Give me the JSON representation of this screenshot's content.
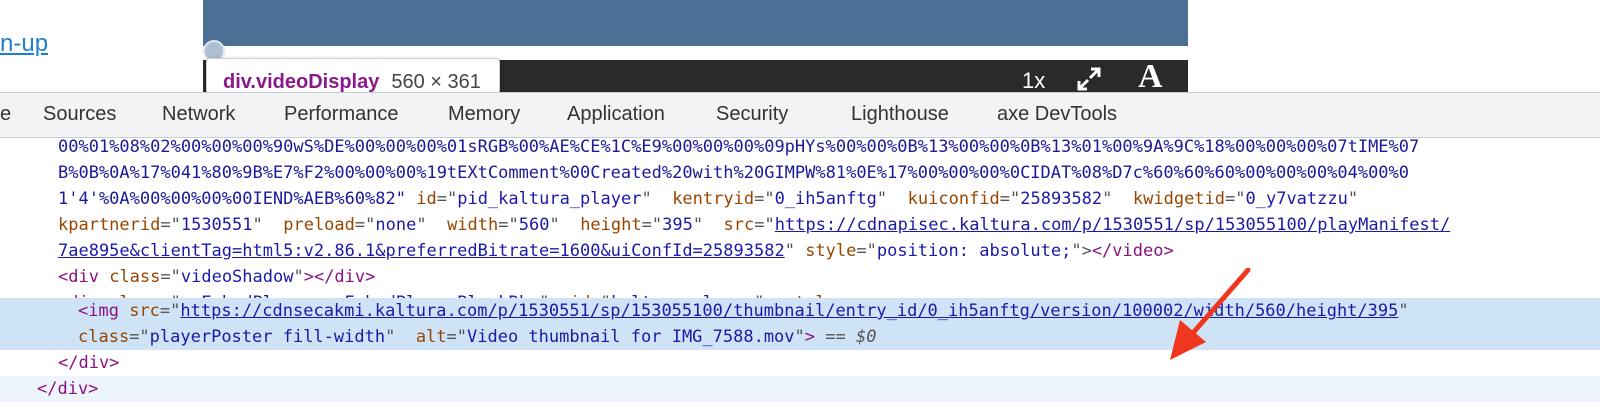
{
  "page": {
    "link_text": "n-up",
    "tooltip": {
      "name": "div.videoDisplay",
      "dims": "560 × 361"
    },
    "player_controls": {
      "rate": "1x",
      "a_label": "A"
    }
  },
  "devtools": {
    "tabs": [
      "Sources",
      "Network",
      "Performance",
      "Memory",
      "Application",
      "Security",
      "Lighthouse",
      "axe DevTools"
    ],
    "clipped_tab": "e"
  },
  "code": {
    "line1": "00%01%08%02%00%00%00%90wS%DE%00%00%00%01sRGB%00%AE%CE%1C%E9%00%00%00%09pHYs%00%00%0B%13%00%00%0B%13%01%00%9A%9C%18%00%00%00%07tIME%07",
    "line2": "B%0B%0A%17%041%80%9B%E7%F2%00%00%00%19tEXtComment%00Created%20with%20GIMPW%81%0E%17%00%00%00%0CIDAT%08%D7c%60%60%60%00%00%00%04%00%0",
    "line3_prefix": "1'4'%0A%00%00%00%00IEND%AEB%60%82\"",
    "attrs": {
      "id_name": "id",
      "id_val": "pid_kaltura_player",
      "kentryid_name": "kentryid",
      "kentryid_val": "0_ih5anftg",
      "kuiconf_name": "kuiconfid",
      "kuiconf_val": "25893582",
      "kwidget_name": "kwidgetid",
      "kwidget_val": "0_y7vatzzu",
      "kpartner_name": "kpartnerid",
      "kpartner_val": "1530551",
      "preload_name": "preload",
      "preload_val": "none",
      "width_name": "width",
      "width_val": "560",
      "height_name": "height",
      "height_val": "395",
      "src_name": "src",
      "src_val": "https://cdnapisec.kaltura.com/p/1530551/sp/153055100/playManifest/",
      "line5_link": "7ae895e&clientTag=html5:v2.86.1&preferredBitrate=1600&uiConfId=25893582",
      "style_name": "style",
      "style_val": "position: absolute;",
      "close_video": "</video>"
    },
    "div_shadow": {
      "open": "<div",
      "class_name": "class",
      "class_val": "videoShadow",
      "close": "></div>"
    },
    "div_player": {
      "open": "<div",
      "class_name": "class",
      "class_val": "mwEmbedPlayer mwEmbedPlayerBlackBkg",
      "id_name": "id",
      "id_val": "kaltura_player",
      "style_name": "style",
      "end": ">"
    },
    "img": {
      "open": "<img",
      "src_name": "src",
      "src_val": "https://cdnsecakmi.kaltura.com/p/1530551/sp/153055100/thumbnail/entry_id/0_ih5anftg/version/100002/width/560/height/395",
      "class_name": "class",
      "class_val": "playerPoster fill-width",
      "alt_name": "alt",
      "alt_val": "Video thumbnail for IMG_7588.mov",
      "end": ">",
      "eq": "==",
      "sym": "$0"
    },
    "close_div_inner": "</div>",
    "close_div_outer": "</div>"
  },
  "colors": {
    "selected_row": "#cfe3f7",
    "arrow": "#f0371e",
    "tag": "#881280",
    "attr": "#994500",
    "value": "#1a1aa6"
  }
}
